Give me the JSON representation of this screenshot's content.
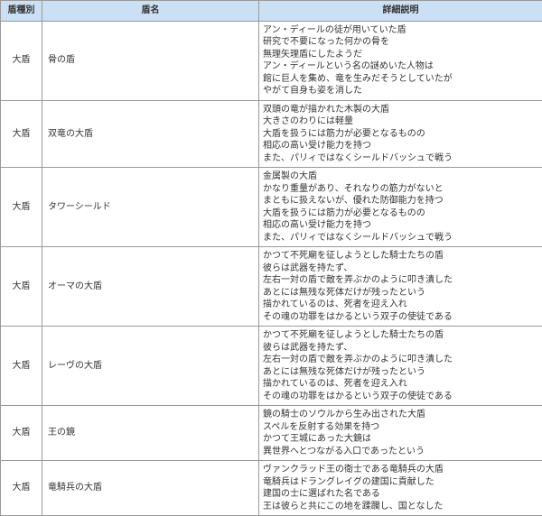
{
  "headers": {
    "category": "盾種別",
    "name": "盾名",
    "desc": "詳細説明"
  },
  "rows": [
    {
      "category": "大盾",
      "name": "骨の盾",
      "desc": [
        "アン・ディールの徒が用いていた盾",
        "研究で不要になった何かの骨を",
        "無理矢理盾にしたようだ",
        "アン・ディールという名の謎めいた人物は",
        "館に巨人を集め、竜を生みだそうとしていたが",
        "やがて自身も姿を消した"
      ]
    },
    {
      "category": "大盾",
      "name": "双竜の大盾",
      "desc": [
        "双頭の竜が描かれた木製の大盾",
        "大きさのわりには軽量",
        "大盾を扱うには筋力が必要となるものの",
        "相応の高い受け能力を持つ",
        "また、パリィではなくシールドバッシュで戦う"
      ]
    },
    {
      "category": "大盾",
      "name": "タワーシールド",
      "desc": [
        "金属製の大盾",
        "かなり重量があり、それなりの筋力がないと",
        "まともに扱えないが、優れた防御能力を持つ",
        "大盾を扱うには筋力が必要となるものの",
        "相応の高い受け能力を持つ",
        "また、パリィではなくシールドバッシュで戦う"
      ]
    },
    {
      "category": "大盾",
      "name": "オーマの大盾",
      "desc": [
        "かつて不死廟を征しようとした騎士たちの盾",
        "彼らは武器を持たず、",
        "左右一対の盾で敵を弄ぶかのように叩き潰した",
        "あとには無残な死体だけが残ったという",
        "描かれているのは、死者を迎え入れ",
        "その魂の功罪をはかるという双子の使徒である"
      ]
    },
    {
      "category": "大盾",
      "name": "レーヴの大盾",
      "desc": [
        "かつて不死廟を征しようとした騎士たちの盾",
        "彼らは武器を持たず、",
        "左右一対の盾で敵を弄ぶかのように叩き潰した",
        "あとには無残な死体だけが残ったという",
        "描かれているのは、死者を迎え入れ",
        "その魂の功罪をはかるという双子の使徒である"
      ]
    },
    {
      "category": "大盾",
      "name": "王の鏡",
      "desc": [
        "鏡の騎士のソウルから生み出された大盾",
        "スペルを反射する効果を持つ",
        "かつて王城にあった大鏡は",
        "異世界へとつながる入口であったという"
      ]
    },
    {
      "category": "大盾",
      "name": "竜騎兵の大盾",
      "desc": [
        "ヴァンクラッド王の衛士である竜騎兵の大盾",
        "竜騎兵はドラングレイグの建国に貢献した",
        "建国の士に選ばれた名である",
        "王は彼らと共にこの地を蹂躙し、国となした"
      ]
    }
  ]
}
